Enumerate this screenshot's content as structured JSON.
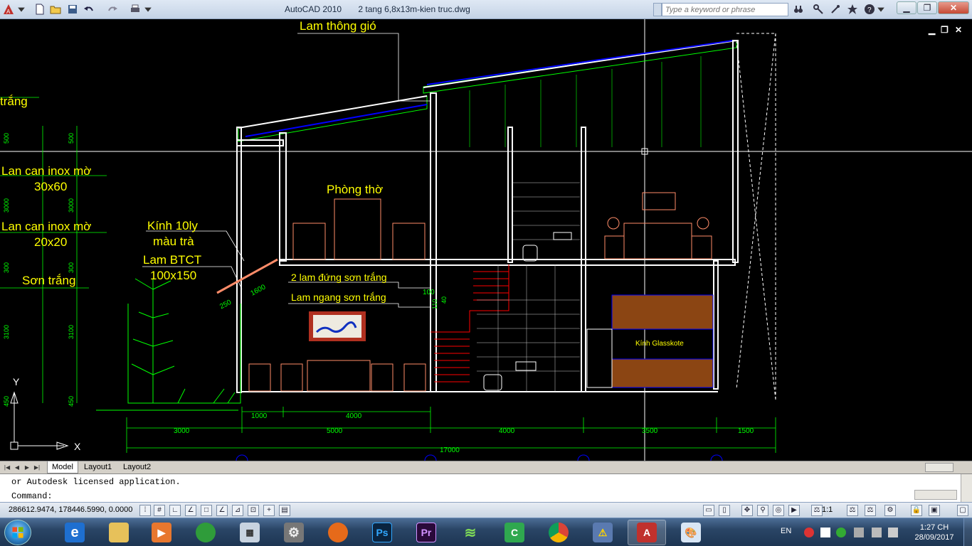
{
  "window": {
    "app_name": "AutoCAD 2010",
    "file_name": "2 tang 6,8x13m-kien truc.dwg",
    "search_placeholder": "Type a keyword or phrase"
  },
  "drawing": {
    "labels": {
      "lam_thong_gio": "Lam thông gió",
      "trang": "trắng",
      "lan_can_1": "Lan can inox mờ",
      "lan_can_1_size": "30x60",
      "lan_can_2": "Lan can inox mờ",
      "lan_can_2_size": "20x20",
      "son_trang": "Sơn trắng",
      "kinh": "Kính 10ly",
      "kinh_mau": "màu trà",
      "lam_btct": "Lam BTCT",
      "lam_btct_size": "100x150",
      "phong_tho": "Phòng thờ",
      "lam_dung": "2 lam đứng sơn trắng",
      "lam_ngang": "Lam ngang sơn trắng",
      "kinh_glasskote": "Kính Glasskote"
    },
    "dims_horizontal": {
      "d1000": "1000",
      "d4000a": "4000",
      "d3000": "3000",
      "d5000": "5000",
      "d4000b": "4000",
      "d3500": "3500",
      "d1500": "1500",
      "d17000": "17000"
    },
    "dims_vertical": {
      "v500a": "500",
      "v500b": "500",
      "v3000a": "3000",
      "v3000b": "3000",
      "v300a": "300",
      "v300b": "300",
      "v3100a": "3100",
      "v3100b": "3100",
      "v450a": "450",
      "v450b": "450"
    },
    "dims_misc": {
      "d1600": "1600",
      "d250": "250",
      "d100": "100",
      "d110": "110",
      "d40": "40"
    },
    "axis": {
      "y": "Y",
      "x": "X"
    }
  },
  "tabs": {
    "model": "Model",
    "layout1": "Layout1",
    "layout2": "Layout2"
  },
  "command": {
    "history": "or Autodesk licensed application.",
    "prompt": "Command:"
  },
  "status": {
    "coordinates": "286612.9474, 178446.5990, 0.0000",
    "annotation_scale": "1:1"
  },
  "taskbar": {
    "language": "EN",
    "time": "1:27 CH",
    "date": "28/09/2017"
  },
  "colors": {
    "cad_background": "#000000",
    "annotation_yellow": "#ffff00",
    "wall_white": "#ffffff",
    "dimension_green": "#00ff00",
    "roof_blue": "#0000ff",
    "furniture_salmon": "#ff8c69",
    "stair_red": "#ff0000"
  }
}
